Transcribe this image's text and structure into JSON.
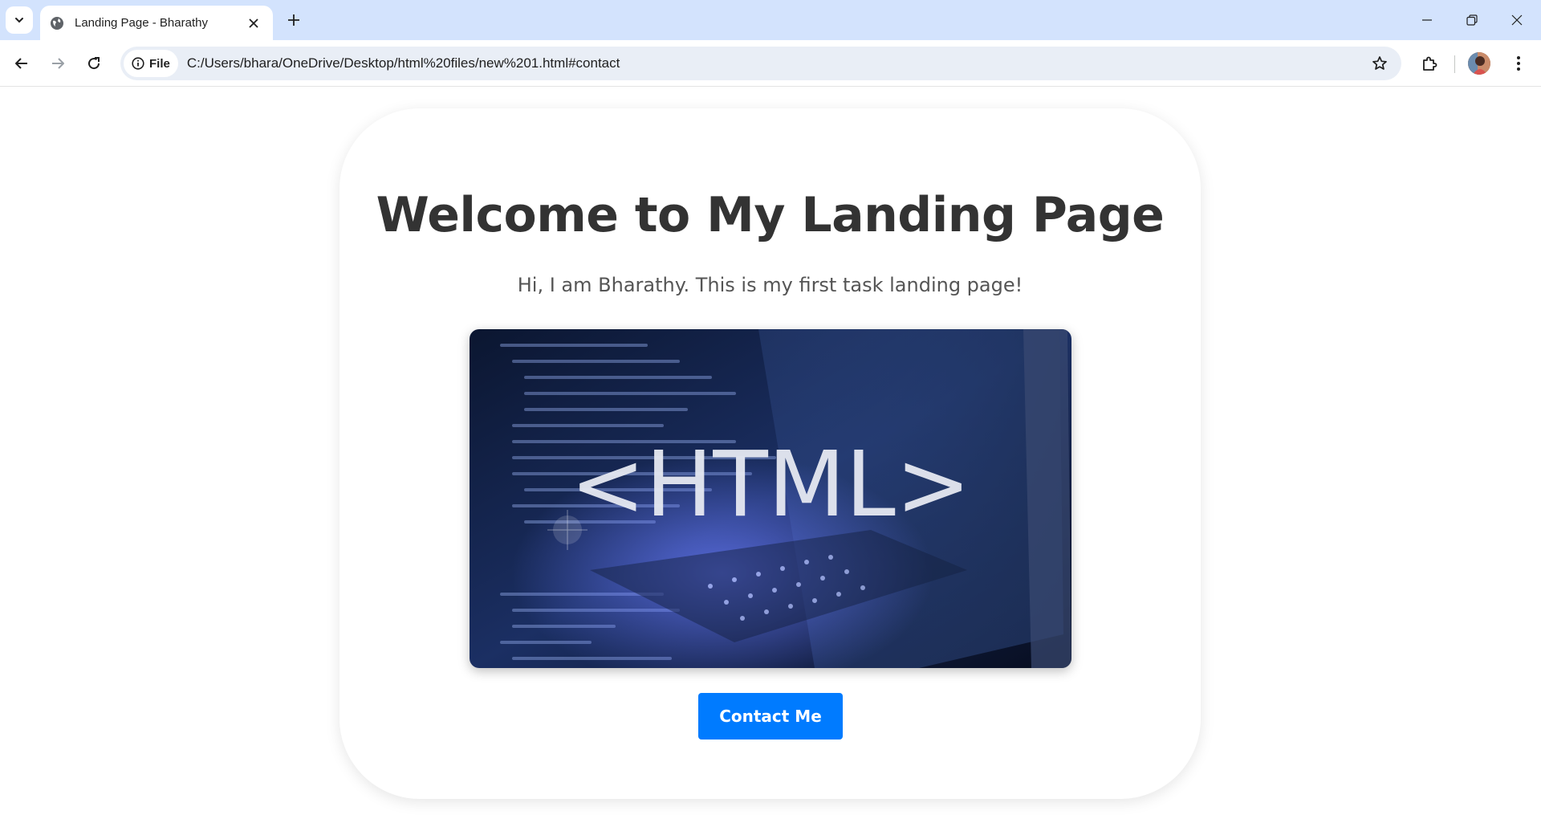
{
  "browser": {
    "tab_title": "Landing Page - Bharathy",
    "site_chip_label": "File",
    "url": "C:/Users/bhara/OneDrive/Desktop/html%20files/new%201.html#contact"
  },
  "page": {
    "heading": "Welcome to My Landing Page",
    "subtitle": "Hi, I am Bharathy. This is my first task landing page!",
    "hero_image_text": "<HTML>",
    "contact_button_label": "Contact Me"
  },
  "colors": {
    "tab_strip": "#d3e3fd",
    "omnibox": "#e9eef6",
    "accent_button": "#007bff",
    "heading_text": "#333333",
    "subtitle_text": "#555555"
  }
}
